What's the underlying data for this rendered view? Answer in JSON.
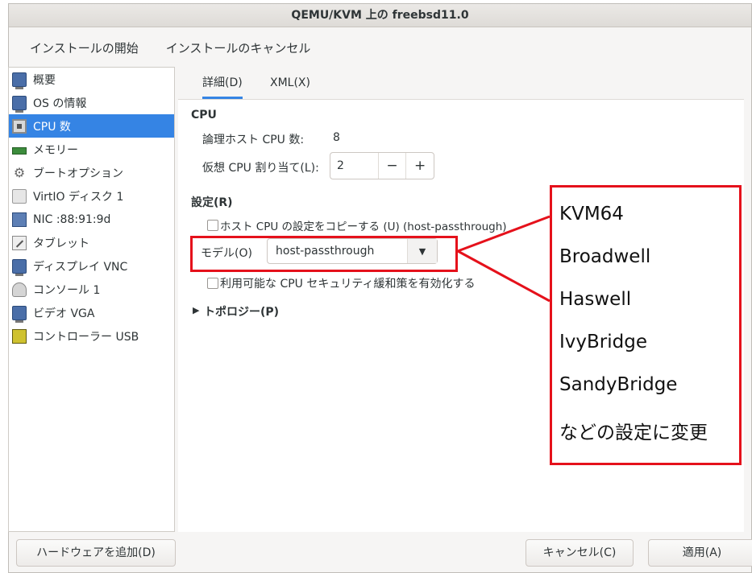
{
  "window": {
    "title": "QEMU/KVM 上の freebsd11.0"
  },
  "menubar": {
    "begin_install": "インストールの開始",
    "cancel_install": "インストールのキャンセル"
  },
  "sidebar": {
    "items": [
      {
        "label": "概要",
        "icon": "monitor-icon"
      },
      {
        "label": "OS の情報",
        "icon": "monitor-icon"
      },
      {
        "label": "CPU 数",
        "icon": "cpu-icon",
        "selected": true
      },
      {
        "label": "メモリー",
        "icon": "ram-icon"
      },
      {
        "label": "ブートオプション",
        "icon": "gear-icon"
      },
      {
        "label": "VirtIO ディスク 1",
        "icon": "disk-icon"
      },
      {
        "label": "NIC :88:91:9d",
        "icon": "nic-icon"
      },
      {
        "label": "タブレット",
        "icon": "tablet-icon"
      },
      {
        "label": "ディスプレイ VNC",
        "icon": "display-icon"
      },
      {
        "label": "コンソール 1",
        "icon": "console-icon"
      },
      {
        "label": "ビデオ VGA",
        "icon": "video-icon"
      },
      {
        "label": "コントローラー USB",
        "icon": "usb-icon"
      }
    ]
  },
  "tabs": {
    "details": "詳細(D)",
    "xml": "XML(X)"
  },
  "cpu": {
    "section_title": "CPU",
    "logical_label": "論理ホスト CPU 数:",
    "logical_value": "8",
    "alloc_label": "仮想 CPU 割り当て(L):",
    "alloc_value": "2",
    "minus": "−",
    "plus": "+"
  },
  "config": {
    "section_title": "設定(R)",
    "copy_host_label": "ホスト  CPU の設定をコピーする (U) (host-passthrough)",
    "model_label": "モデル(O)",
    "model_value": "host-passthrough",
    "security_label": "利用可能な CPU セキュリティ緩和策を有効化する",
    "topology_label": "トポロジー(P)"
  },
  "buttons": {
    "add_hardware": "ハードウェアを追加(D)",
    "cancel": "キャンセル(C)",
    "apply": "適用(A)"
  },
  "callout": {
    "lines": [
      "KVM64",
      "Broadwell",
      "Haswell",
      "IvyBridge",
      "SandyBridge",
      "などの設定に変更"
    ]
  },
  "colors": {
    "accent": "#3584e4",
    "annotation_red": "#e5111b"
  }
}
